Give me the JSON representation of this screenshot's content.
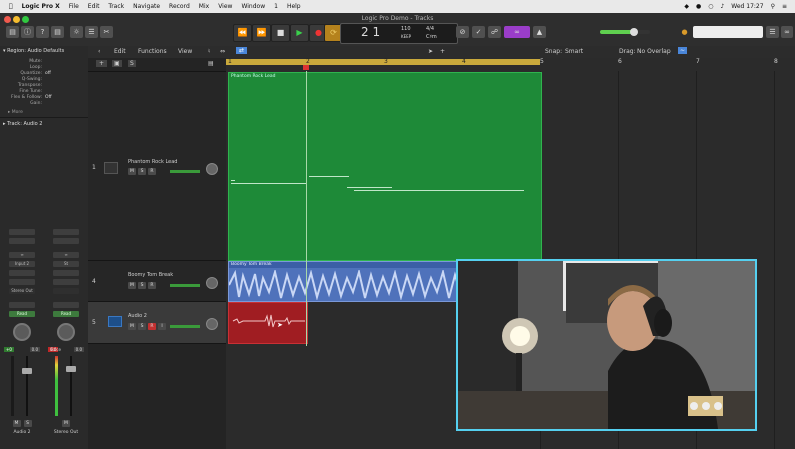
{
  "menubar": {
    "items": [
      "Logic Pro X",
      "File",
      "Edit",
      "Track",
      "Navigate",
      "Record",
      "Mix",
      "View",
      "Window",
      "1",
      "Help"
    ],
    "clock": "Wed 17:27"
  },
  "window_title": "Logic Pro Demo - Tracks",
  "lcd": {
    "position": "2  1",
    "tempo": "110",
    "tempo_sub": "KEEP",
    "signature": "4/4",
    "key": "C♯m"
  },
  "inspector": {
    "region_header": "Region: Audio Defaults",
    "params": [
      {
        "k": "Mute:",
        "v": ""
      },
      {
        "k": "Loop:",
        "v": ""
      },
      {
        "k": "Quantize:",
        "v": "off"
      },
      {
        "k": "Q-Swing:",
        "v": ""
      },
      {
        "k": "Transpose:",
        "v": ""
      },
      {
        "k": "Fine Tune:",
        "v": ""
      },
      {
        "k": "Flex & Follow:",
        "v": "Off"
      },
      {
        "k": "Gain:",
        "v": ""
      }
    ],
    "more_label": "▸ More",
    "track_header": "Track: Audio 2",
    "strip1": {
      "input": "Input 2",
      "output": "Stereo Out",
      "read": "Read",
      "peak_l": "+0",
      "peak_r": "0.0",
      "name": "Audio 2"
    },
    "strip2": {
      "input": "St",
      "output": "",
      "read": "Read",
      "peak_l": "0.0",
      "peak_r": "0.0",
      "name": "Stereo Out",
      "bnce": "Bnce"
    }
  },
  "toolbar": {
    "edit": "Edit",
    "functions": "Functions",
    "view": "View",
    "snap_label": "Snap:",
    "snap_value": "Smart",
    "drag_label": "Drag:",
    "drag_value": "No Overlap"
  },
  "ruler_marks": [
    "1",
    "2",
    "3",
    "4",
    "5",
    "6",
    "7",
    "8"
  ],
  "tracks": [
    {
      "num": "1",
      "name": "Phantom Rock Lead"
    },
    {
      "num": "4",
      "name": "Boomy Tom Break"
    },
    {
      "num": "5",
      "name": "Audio 2"
    }
  ],
  "regions": {
    "r1": "Phantom Rock Lead",
    "r2": "Boomy Tom Break"
  },
  "colors": {
    "green_region": "#1e8a38",
    "blue_region": "#4f72bb",
    "red_region": "#a01d22",
    "accent": "#55d0f0"
  }
}
